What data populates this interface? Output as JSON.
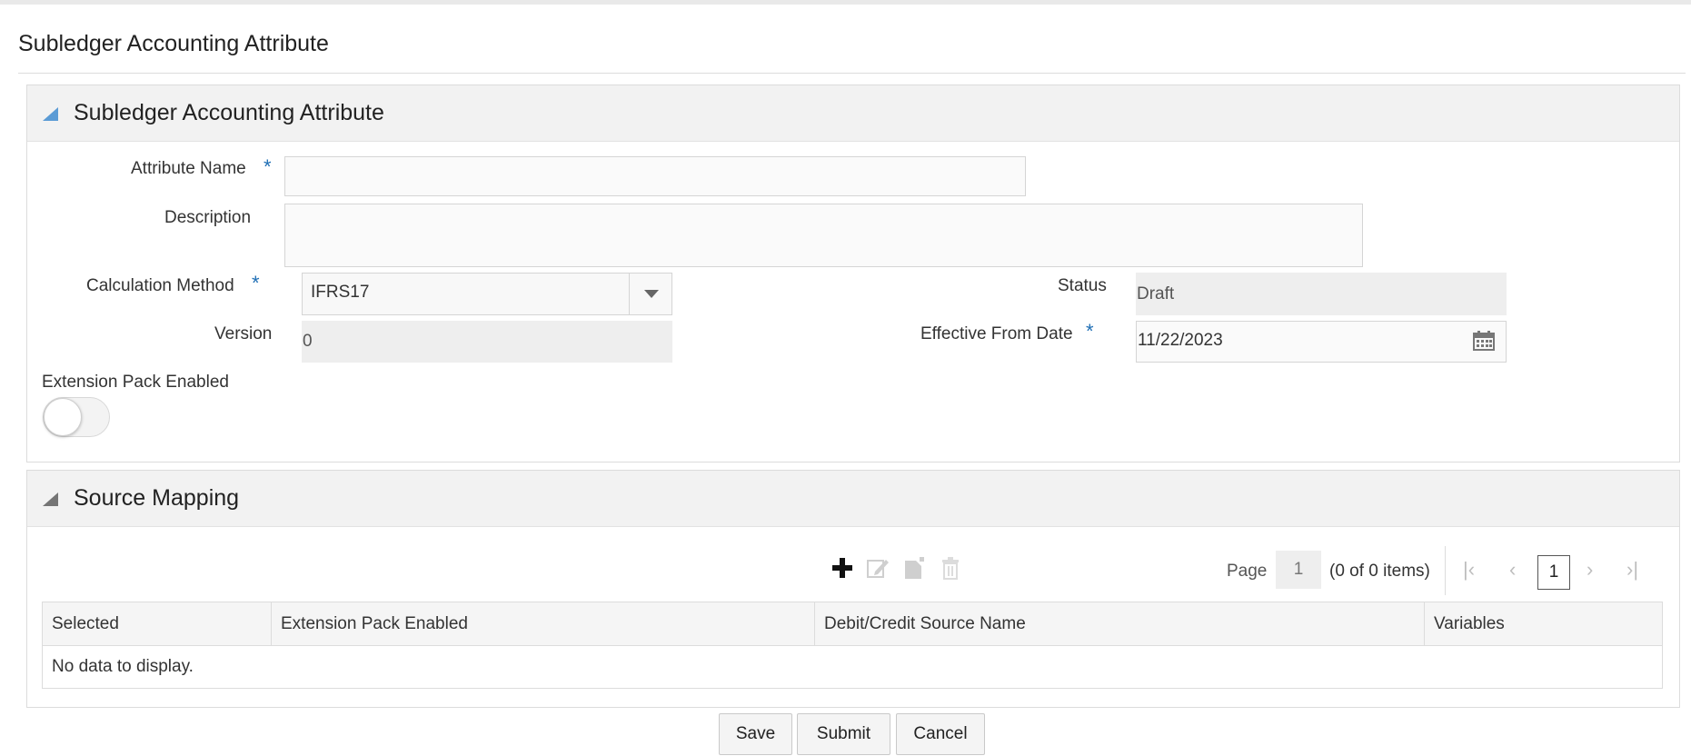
{
  "page": {
    "title": "Subledger Accounting Attribute"
  },
  "section1": {
    "title": "Subledger Accounting Attribute",
    "attribute_name": {
      "label": "Attribute Name",
      "required": "*",
      "value": ""
    },
    "description": {
      "label": "Description",
      "value": ""
    },
    "calculation_method": {
      "label": "Calculation Method",
      "required": "*",
      "value": "IFRS17"
    },
    "status": {
      "label": "Status",
      "value": "Draft"
    },
    "version": {
      "label": "Version",
      "value": "0"
    },
    "effective_from_date": {
      "label": "Effective From Date",
      "required": "*",
      "value": "11/22/2023"
    },
    "extension_pack": {
      "label": "Extension Pack Enabled",
      "enabled": false
    }
  },
  "section2": {
    "title": "Source Mapping",
    "toolbar": {
      "icons": [
        "add-icon",
        "edit-icon",
        "copy-icon",
        "delete-icon"
      ]
    },
    "pager": {
      "page_label": "Page",
      "page_value": "1",
      "items_text": "(0 of 0 items)",
      "current_page": "1"
    },
    "table": {
      "columns": [
        "Selected",
        "Extension Pack Enabled",
        "Debit/Credit Source Name",
        "Variables"
      ],
      "rows": [],
      "empty_text": "No data to display."
    }
  },
  "buttons": {
    "save": "Save",
    "submit": "Submit",
    "cancel": "Cancel"
  },
  "colors": {
    "accent": "#1f6fb5",
    "section_triangle": "#5b9bd5",
    "header_bg": "#f2f2f2"
  }
}
